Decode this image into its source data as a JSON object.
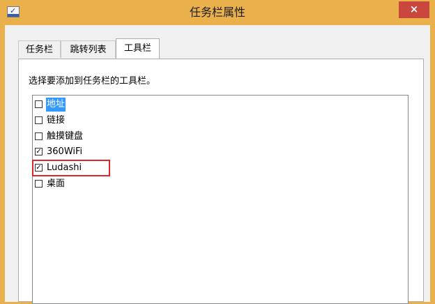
{
  "window": {
    "title": "任务栏属性",
    "close_label": "×"
  },
  "tabs": [
    {
      "label": "任务栏",
      "active": false
    },
    {
      "label": "跳转列表",
      "active": false
    },
    {
      "label": "工具栏",
      "active": true
    }
  ],
  "panel": {
    "instruction": "选择要添加到任务栏的工具栏。"
  },
  "toolbars": [
    {
      "label": "地址",
      "checked": false,
      "selected": true
    },
    {
      "label": "链接",
      "checked": false,
      "selected": false
    },
    {
      "label": "触摸键盘",
      "checked": false,
      "selected": false
    },
    {
      "label": "360WiFi",
      "checked": true,
      "selected": false
    },
    {
      "label": "Ludashi",
      "checked": true,
      "selected": false,
      "highlighted": true
    },
    {
      "label": "桌面",
      "checked": false,
      "selected": false
    }
  ],
  "colors": {
    "titlebar": "#e9b04c",
    "close_button": "#c9473d",
    "selection": "#3399ff",
    "highlight_outline": "#e0262b"
  },
  "icons": {
    "app": "taskbar-properties-icon",
    "close": "close-icon"
  }
}
